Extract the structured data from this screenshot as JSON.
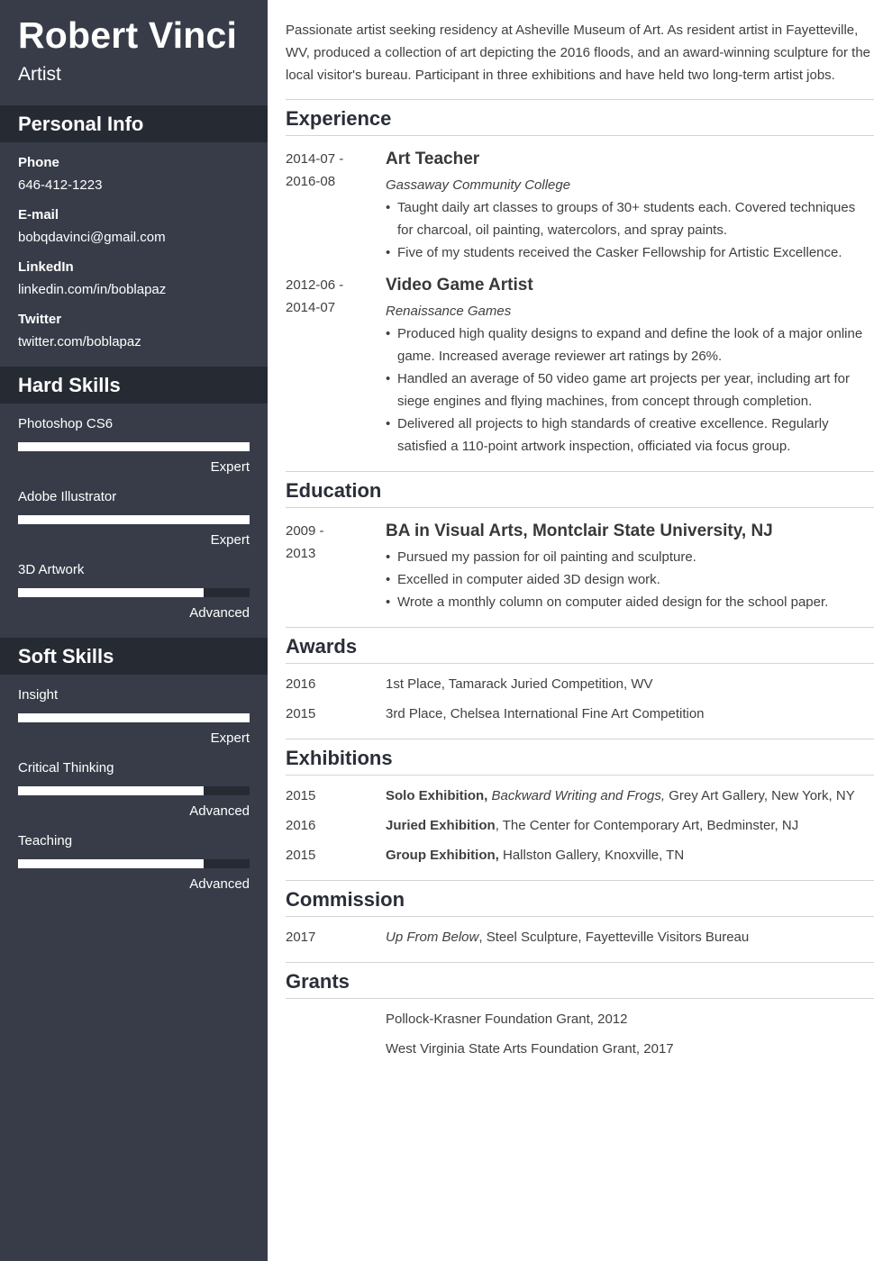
{
  "header": {
    "name": "Robert Vinci",
    "title": "Artist"
  },
  "sidebar": {
    "personal_info": {
      "heading": "Personal Info",
      "fields": [
        {
          "label": "Phone",
          "value": "646-412-1223"
        },
        {
          "label": "E-mail",
          "value": "bobqdavinci@gmail.com"
        },
        {
          "label": "LinkedIn",
          "value": "linkedin.com/in/boblapaz"
        },
        {
          "label": "Twitter",
          "value": "twitter.com/boblapaz"
        }
      ]
    },
    "hard_skills": {
      "heading": "Hard Skills",
      "items": [
        {
          "name": "Photoshop CS6",
          "level": "Expert",
          "fill_fraction": 1.0
        },
        {
          "name": "Adobe Illustrator",
          "level": "Expert",
          "fill_fraction": 1.0
        },
        {
          "name": "3D Artwork",
          "level": "Advanced",
          "fill_fraction": 0.8
        }
      ]
    },
    "soft_skills": {
      "heading": "Soft Skills",
      "items": [
        {
          "name": "Insight",
          "level": "Expert",
          "fill_fraction": 1.0
        },
        {
          "name": "Critical Thinking",
          "level": "Advanced",
          "fill_fraction": 0.8
        },
        {
          "name": "Teaching",
          "level": "Advanced",
          "fill_fraction": 0.8
        }
      ]
    }
  },
  "main": {
    "summary": "Passionate artist seeking residency at Asheville Museum of Art. As resident artist in Fayetteville, WV, produced a collection of art depicting the 2016 floods, and an award-winning sculpture for the local visitor's bureau. Participant in three exhibitions and have held two long-term artist jobs.",
    "experience": {
      "heading": "Experience",
      "jobs": [
        {
          "date_start": "2014-07 -",
          "date_end": "2016-08",
          "title": "Art Teacher",
          "company": "Gassaway Community College",
          "bullets": [
            "Taught daily art classes to groups of 30+ students each. Covered techniques for charcoal, oil painting, watercolors, and spray paints.",
            "Five of my students received the Casker Fellowship for Artistic Excellence."
          ]
        },
        {
          "date_start": "2012-06 -",
          "date_end": "2014-07",
          "title": "Video Game Artist",
          "company": "Renaissance Games",
          "bullets": [
            "Produced high quality designs to expand and define the look of a major online game. Increased average reviewer art ratings by 26%.",
            "Handled an average of 50 video game art projects per year, including art for siege engines and flying machines, from concept through completion.",
            "Delivered all projects to high standards of creative excellence. Regularly satisfied a 110-point artwork inspection, officiated via focus group."
          ]
        }
      ]
    },
    "education": {
      "heading": "Education",
      "date_start": "2009 -",
      "date_end": "2013",
      "degree": "BA in Visual Arts, Montclair State University, NJ",
      "bullets": [
        "Pursued my passion for oil painting and sculpture.",
        "Excelled in computer aided 3D design work.",
        "Wrote a monthly column on computer aided design for the school paper."
      ]
    },
    "awards": {
      "heading": "Awards",
      "items": [
        {
          "year": "2016",
          "text": "1st Place, Tamarack Juried Competition, WV"
        },
        {
          "year": "2015",
          "text": "3rd Place, Chelsea International Fine Art Competition"
        }
      ]
    },
    "exhibitions": {
      "heading": "Exhibitions",
      "items": [
        {
          "year": "2015",
          "bold": "Solo Exhibition,",
          "italic": " Backward Writing and Frogs,",
          "rest": " Grey Art Gallery, New York, NY"
        },
        {
          "year": "2016",
          "bold": "Juried Exhibition",
          "italic": "",
          "rest": ", The Center for Contemporary Art, Bedminster, NJ"
        },
        {
          "year": "2015",
          "bold": "Group Exhibition,",
          "italic": "",
          "rest": " Hallston Gallery, Knoxville, TN"
        }
      ]
    },
    "commission": {
      "heading": "Commission",
      "items": [
        {
          "year": "2017",
          "italic": "Up From Below",
          "rest": ", Steel Sculpture, Fayetteville Visitors Bureau"
        }
      ]
    },
    "grants": {
      "heading": "Grants",
      "items": [
        "Pollock-Krasner Foundation Grant, 2012",
        "West Virginia State Arts Foundation Grant, 2017"
      ]
    }
  },
  "colors": {
    "sidebar_bg": "#373c48",
    "sidebar_heading_bg": "#262a33",
    "bar_fill": "#ffffff",
    "divider": "#d4d4d4"
  }
}
